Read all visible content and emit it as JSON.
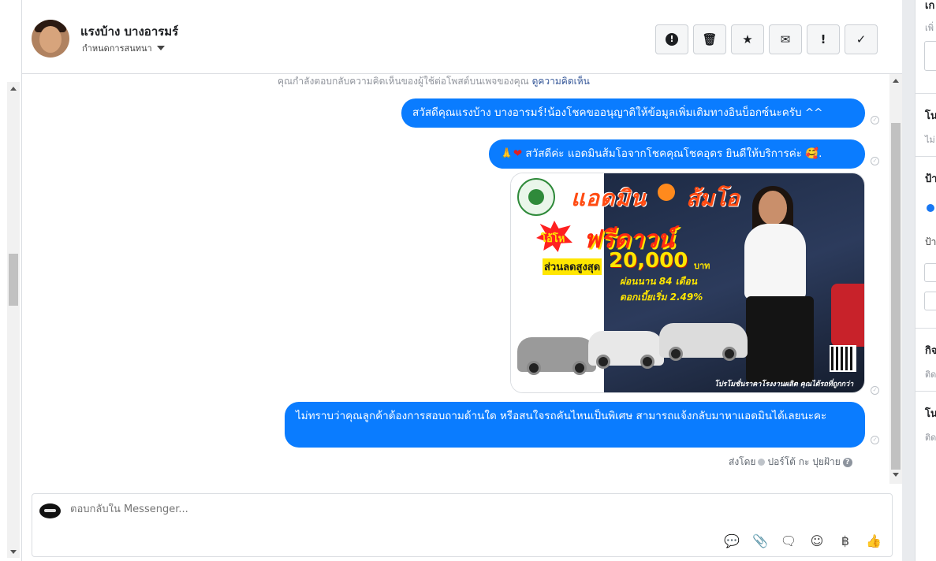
{
  "conversation": {
    "contact_name": "แรงบ้าง บางอารมร์",
    "assign_label": "กำหนดการสนทนา",
    "actions": [
      {
        "name": "spam-button",
        "glyph": "!"
      },
      {
        "name": "delete-button",
        "glyph": "🗑"
      },
      {
        "name": "star-button",
        "glyph": "★"
      },
      {
        "name": "mark-unread-button",
        "glyph": "✉"
      },
      {
        "name": "follow-up-button",
        "glyph": "!"
      },
      {
        "name": "done-button",
        "glyph": "✓"
      }
    ]
  },
  "chat": {
    "context_text": "คุณกำลังตอบกลับความคิดเห็นของผู้ใช้ต่อโพสต์บนเพจของคุณ",
    "context_link": "ดูความคิดเห็น",
    "msg1": "สวัสดีคุณแรงบ้าง บางอารมร์!น้องโชคขออนุญาติให้ข้อมูลเพิ่มเติมทางอินบ็อกซ์นะครับ ^^",
    "msg2_emoji_pray": "🙏",
    "msg2_emoji_heart": "❤",
    "msg2_text": " สวัสดีค่ะ แอดมินส้มโอจากโชคคุณโชคอุดร ยินดีให้บริการค่ะ ",
    "msg2_emoji_end": "🥰.",
    "msg4": "ไม่ทราบว่าคุณลูกค้าต้องการสอบถามด้านใด หรือสนใจรถคันไหนเป็นพิเศษ สามารถแจ้งกลับมาหาแอดมินได้เลยนะคะ",
    "sent_by_label": "ส่งโดย",
    "sent_by_name": "ปอร์โต้ กะ ปุยฝ้าย",
    "help_glyph": "?"
  },
  "promo_image": {
    "title_left": "แอดมิน",
    "title_right": "ส้มโอ",
    "burst_text": "โอ้โห",
    "free_down": "ฟรีดาวน์",
    "discount_label": "ส่วนลดสูงสุด",
    "discount_value": "20,000",
    "discount_unit": "บาท",
    "installment": "ผ่อนนาน 84 เดือน",
    "rate": "ดอกเบี้ยเริ่ม 2.49%",
    "footer": "โปรโมชั่นราคาโรงงานผลิต คุณได้รถที่ถูกกว่า"
  },
  "composer": {
    "placeholder": "ตอบกลับใน Messenger...",
    "tools": [
      {
        "name": "saved-reply-icon",
        "glyph": "💬"
      },
      {
        "name": "attach-icon",
        "glyph": "📎"
      },
      {
        "name": "quick-reply-icon",
        "glyph": "🗨"
      },
      {
        "name": "emoji-icon",
        "glyph": "☺"
      },
      {
        "name": "payment-icon",
        "glyph": "฿"
      },
      {
        "name": "like-icon",
        "glyph": "👍"
      }
    ]
  },
  "right_panel": {
    "items": [
      {
        "title": "เก",
        "sub": "เพิ่"
      },
      {
        "title": "โน",
        "sub": "ไม่"
      },
      {
        "title": "ป้า",
        "sub": "ป้า"
      },
      {
        "title": "กิจ",
        "sub": "ติด"
      },
      {
        "title": "โน",
        "sub": "ติด"
      }
    ]
  },
  "colors": {
    "bubble": "#0a7cff",
    "link": "#365899",
    "border": "#dadde1"
  }
}
